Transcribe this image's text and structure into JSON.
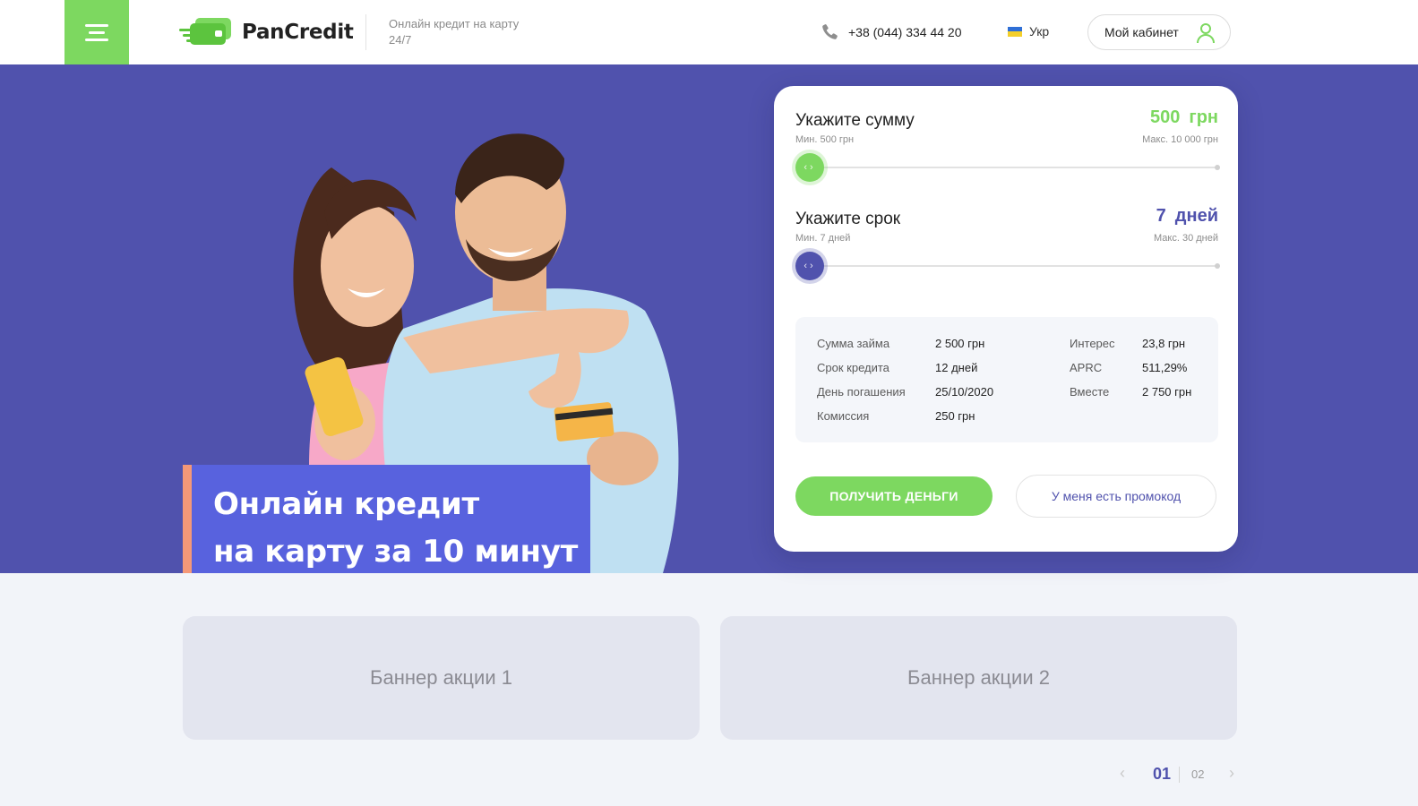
{
  "header": {
    "brand": "PanCredit",
    "tagline": "Онлайн кредит на карту 24/7",
    "phone": "+38 (044) 334 44 20",
    "language": "Укр",
    "cabinet_label": "Мой кабинет"
  },
  "hero": {
    "title_line1": "Онлайн кредит",
    "title_line2": "на карту за 10 минут"
  },
  "calculator": {
    "amount": {
      "label": "Укажите сумму",
      "min_label": "Мин. 500 грн",
      "max_label": "Макс. 10 000 грн",
      "value": "500",
      "unit": "грн",
      "level": 0
    },
    "term": {
      "label": "Укажите срок",
      "min_label": "Мин. 7 дней",
      "max_label": "Макс. 30 дней",
      "value": "7",
      "unit": "дней",
      "level": 0
    },
    "summary": {
      "left": [
        {
          "key": "Сумма займа",
          "value": "2 500 грн"
        },
        {
          "key": "Срок кредита",
          "value": "12 дней"
        },
        {
          "key": "День погашения",
          "value": "25/10/2020"
        },
        {
          "key": "Комиссия",
          "value": "250 грн"
        }
      ],
      "right": [
        {
          "key": "Интерес",
          "value": "23,8 грн"
        },
        {
          "key": "APRC",
          "value": "511,29%"
        },
        {
          "key": "Вместе",
          "value": "2 750 грн"
        }
      ]
    },
    "get_money_label": "ПОЛУЧИТЬ ДЕНЬГИ",
    "promo_label": "У меня есть промокод"
  },
  "banners": [
    {
      "label": "Баннер акции 1"
    },
    {
      "label": "Баннер акции 2"
    }
  ],
  "pager": {
    "current": "01",
    "next_page": "02",
    "prev_icon": "chevron-left-icon",
    "next_icon": "chevron-right-icon"
  },
  "colors": {
    "hero_bg": "#5052ad",
    "accent_green": "#7dd860",
    "title_box": "#5862de",
    "title_stripe": "#f49878"
  },
  "icons": [
    "menu-icon",
    "logo-icon",
    "phone-icon",
    "flag-ua-icon",
    "user-icon",
    "slider-arrows-icon"
  ]
}
